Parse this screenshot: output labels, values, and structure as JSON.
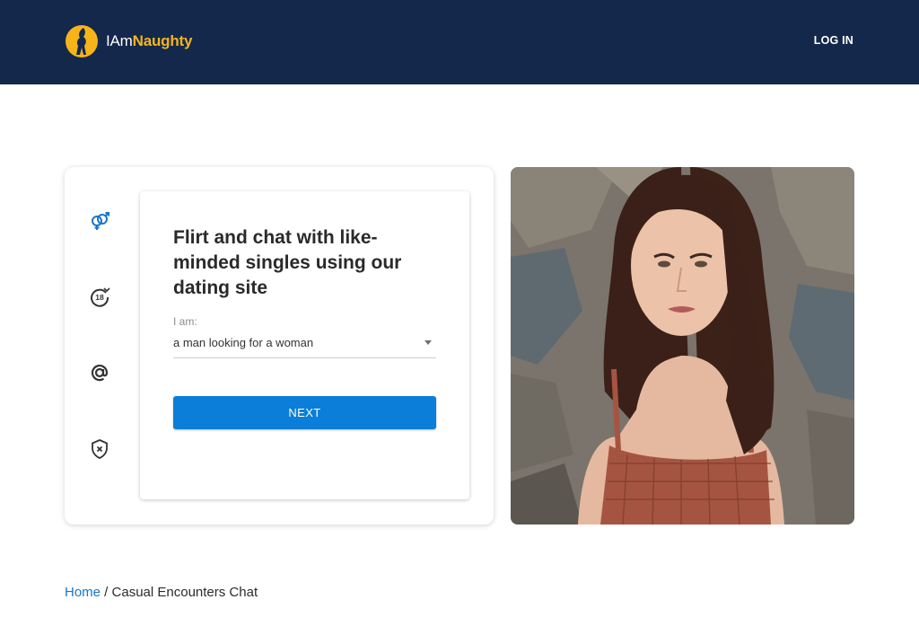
{
  "header": {
    "brand_part1": "IAm",
    "brand_part2": "Naughty",
    "login_label": "LOG IN",
    "logo_icon": "woman-silhouette-logo-icon",
    "bg_color": "#14284b",
    "accent_color": "#f5b51a"
  },
  "steps": [
    {
      "icon": "gender-icon",
      "active": true
    },
    {
      "icon": "age-18-icon",
      "active": false
    },
    {
      "icon": "at-email-icon",
      "active": false
    },
    {
      "icon": "shield-privacy-icon",
      "active": false
    }
  ],
  "form": {
    "headline": "Flirt and chat with like-minded singles using our dating site",
    "field_label": "I am:",
    "select_value": "a man looking for a woman",
    "next_label": "NEXT",
    "button_color": "#0a7ed8"
  },
  "photo": {
    "icon": "woman-portrait-photo"
  },
  "breadcrumb": {
    "home_label": "Home",
    "separator": " / ",
    "current_label": "Casual Encounters Chat",
    "link_color": "#1a76c8"
  }
}
